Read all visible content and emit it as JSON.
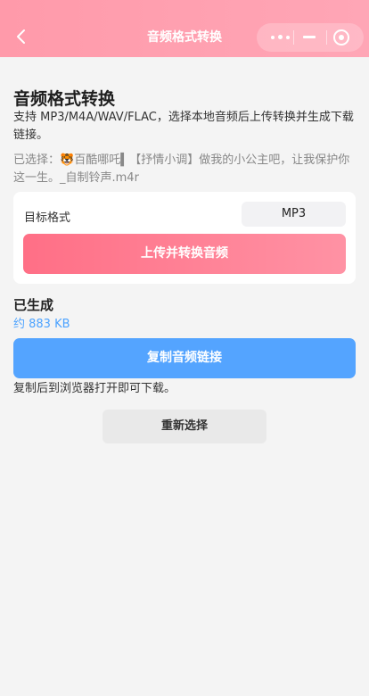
{
  "nav": {
    "title": "音频格式转换",
    "more_icon": "more-dots-icon",
    "minimize_icon": "minimize-icon",
    "close_icon": "target-close-icon",
    "back_icon": "chevron-left-icon",
    "color": "#ff9aaa"
  },
  "page": {
    "title": "音频格式转换",
    "description": "支持 MP3/M4A/WAV/FLAC，选择本地音频后上传转换并生成下载链接。",
    "selected_prefix": "已选择：",
    "selected_file": "🐯百酷哪吒▍【抒情小调】做我的小公主吧，让我保护你这一生。_自制铃声.m4r"
  },
  "card": {
    "format_label": "目标格式",
    "format_value": "MP3",
    "upload_button": "上传并转换音频",
    "button_color": "#ff7088"
  },
  "result": {
    "generated_label": "已生成",
    "size_text": "约 883 KB",
    "copy_button": "复制音频链接",
    "copy_tip": "复制后到浏览器打开即可下载。",
    "accent_color": "#54a4ff"
  },
  "actions": {
    "reselect_button": "重新选择"
  }
}
